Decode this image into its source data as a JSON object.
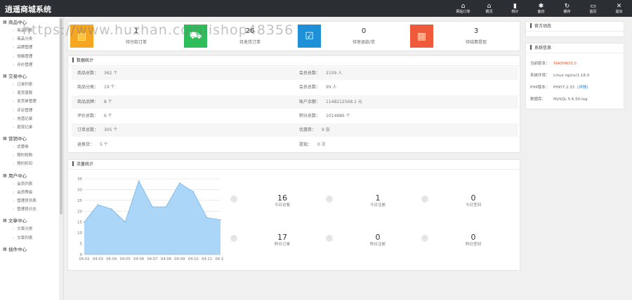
{
  "app": {
    "title": "逍遥商城系统"
  },
  "topnav": [
    {
      "icon": "home-icon",
      "glyph": "⌂",
      "label": "网站订单"
    },
    {
      "icon": "home-icon",
      "glyph": "⌂",
      "label": "概况"
    },
    {
      "icon": "bar-chart-icon",
      "glyph": "▮",
      "label": "统计"
    },
    {
      "icon": "gear-icon",
      "glyph": "✱",
      "label": "备份"
    },
    {
      "icon": "refresh-icon",
      "glyph": "↻",
      "label": "缓存"
    },
    {
      "icon": "monitor-icon",
      "glyph": "▭",
      "label": "首页"
    },
    {
      "icon": "close-icon",
      "glyph": "✕",
      "label": "退出"
    }
  ],
  "sidebar": [
    {
      "title": "商品中心",
      "icon": "grid-icon",
      "items": [
        "商品列表",
        "商品分类",
        "品牌管理",
        "规格管理",
        "评价管理"
      ]
    },
    {
      "title": "交易中心",
      "icon": "bar-chart-icon",
      "items": [
        "订单列表",
        "退货退款",
        "发货单管理",
        "评论管理",
        "充值记录",
        "提现记录"
      ]
    },
    {
      "title": "营销中心",
      "icon": "chart-icon",
      "items": [
        "优惠券",
        "限时抢购",
        "限时折扣"
      ]
    },
    {
      "title": "用户中心",
      "icon": "user-icon",
      "items": [
        "会员列表",
        "会员等级",
        "管理员列表",
        "管理员日志"
      ]
    },
    {
      "title": "文章中心",
      "icon": "doc-icon",
      "items": [
        "文章分类",
        "文章列表"
      ]
    },
    {
      "title": "插件中心",
      "icon": "plug-icon",
      "items": []
    }
  ],
  "watermark": "https://www.huzhan.com/ishop48356",
  "stats": [
    {
      "num": "1",
      "label": "待付款订单",
      "color": "#f5a623",
      "glyph": "▤",
      "icon": "wallet-icon"
    },
    {
      "num": "26",
      "label": "待发货订单",
      "color": "#2dbd5a",
      "glyph": "⛟",
      "icon": "truck-icon"
    },
    {
      "num": "0",
      "label": "待审退款/货",
      "color": "#1e90d8",
      "glyph": "☑",
      "icon": "check-icon"
    },
    {
      "num": "3",
      "label": "待结算提现",
      "color": "#ee5a3a",
      "glyph": "▦",
      "icon": "calculator-icon"
    }
  ],
  "data_panel": {
    "title": "数据统计"
  },
  "data_rows": [
    [
      {
        "k": "商品总数：",
        "v": "362 个"
      },
      {
        "k": "会员总数：",
        "v": "2109 人"
      }
    ],
    [
      {
        "k": "商品分类：",
        "v": "19 个"
      },
      {
        "k": "会员总数：",
        "v": "99 人"
      }
    ],
    [
      {
        "k": "商品品牌：",
        "v": "8 个"
      },
      {
        "k": "账户余额：",
        "v": "1148212568.1 元"
      }
    ],
    [
      {
        "k": "评价总数：",
        "v": "6 个"
      },
      {
        "k": "积分总数：",
        "v": "1014886 个"
      }
    ],
    [
      {
        "k": "订单总数：",
        "v": "305 个"
      },
      {
        "k": "优惠券：",
        "v": "9 张"
      }
    ],
    [
      {
        "k": "退换货：",
        "v": "5 个"
      },
      {
        "k": "提现：",
        "v": "0 次"
      }
    ]
  ],
  "system_news": {
    "title": "官方动态"
  },
  "system_info": {
    "title": "系统信息",
    "rows": [
      {
        "k": "当前版本：",
        "v": "XIAOYAO3.0",
        "tag": ""
      },
      {
        "k": "系统环境：",
        "v": "Linux nginx/1.18.0",
        "tag": ""
      },
      {
        "k": "PHP版本：",
        "v": "PHP/7.2.33",
        "tag": "(详情)"
      },
      {
        "k": "数据库：",
        "v": "MySQL 5.6.50-log",
        "tag": ""
      }
    ]
  },
  "traffic": {
    "title": "流量统计"
  },
  "metrics": [
    {
      "num": "16",
      "label": "今日访客"
    },
    {
      "num": "1",
      "label": "今日注册"
    },
    {
      "num": "0",
      "label": "今日签到"
    },
    {
      "num": "17",
      "label": "昨日订单"
    },
    {
      "num": "0",
      "label": "昨日注册"
    },
    {
      "num": "0",
      "label": "昨日签到"
    }
  ],
  "colors": {
    "area_fill": "#a8d4f7",
    "area_stroke": "#6bb4ee",
    "topbar": "#2b2e33"
  },
  "chart_data": {
    "type": "area",
    "x": [
      "04-02",
      "04-03",
      "04-04",
      "04-05",
      "04-06",
      "04-07",
      "04-08",
      "04-09",
      "04-10",
      "04-11",
      "04-12"
    ],
    "series": [
      {
        "values": [
          15,
          23,
          21,
          15,
          34,
          22,
          22,
          33,
          29,
          17,
          16
        ]
      }
    ],
    "ylim": [
      0,
      35
    ],
    "yticks": [
      0,
      5,
      10,
      15,
      20,
      25,
      30,
      35
    ],
    "grid": true
  }
}
